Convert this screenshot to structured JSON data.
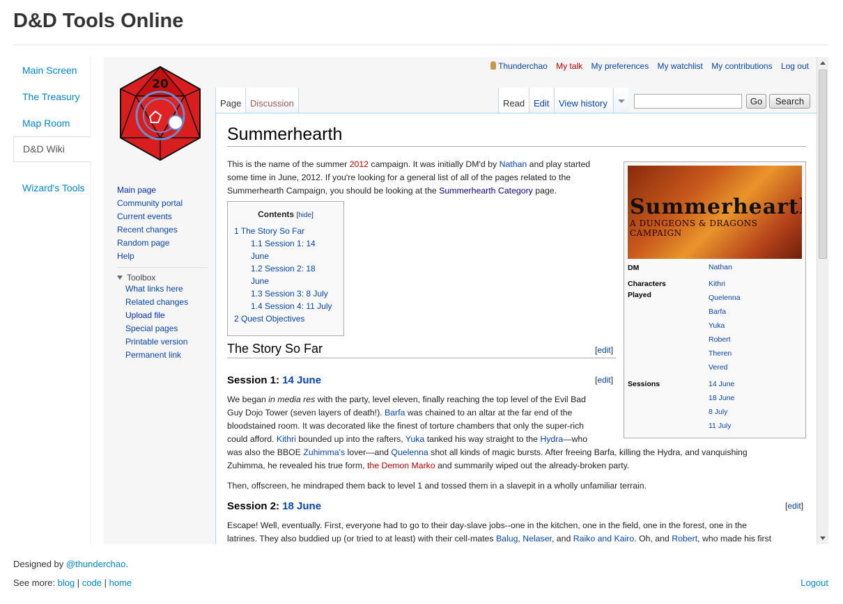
{
  "site": {
    "title": "D&D Tools Online"
  },
  "site_nav": [
    {
      "label": "Main Screen",
      "active": false
    },
    {
      "label": "The Treasury",
      "active": false
    },
    {
      "label": "Map Room",
      "active": false
    },
    {
      "label": "D&D Wiki",
      "active": true
    },
    {
      "label": "Wizard's Tools",
      "active": false
    }
  ],
  "personal": {
    "user": "Thunderchao",
    "talk": "My talk",
    "preferences": "My preferences",
    "watchlist": "My watchlist",
    "contributions": "My contributions",
    "logout": "Log out"
  },
  "tabs": {
    "page": "Page",
    "discussion": "Discussion",
    "read": "Read",
    "edit": "Edit",
    "history": "View history"
  },
  "search": {
    "value": "",
    "go": "Go",
    "search": "Search"
  },
  "logo": {
    "number": "20"
  },
  "wiki_nav": [
    "Main page",
    "Community portal",
    "Current events",
    "Recent changes",
    "Random page",
    "Help"
  ],
  "toolbox": {
    "title": "Toolbox",
    "items": [
      "What links here",
      "Related changes",
      "Upload file",
      "Special pages",
      "Printable version",
      "Permanent link"
    ]
  },
  "article": {
    "title": "Summerhearth",
    "intro": {
      "t1": "This is the name of the summer ",
      "year": "2012",
      "t2": " campaign. It was initially DM'd by ",
      "dm": "Nathan",
      "t3": " and play started",
      "t4": "some time in June, 2012. If you're looking for a general list of all of the pages related to the",
      "t5": "Summerhearth Campaign, you should be looking at the ",
      "cat": "Summerhearth Category",
      "t6": " page."
    },
    "toc": {
      "title": "Contents",
      "hide": "hide",
      "entries": [
        "1 The Story So Far",
        "1.1 Session 1: 14",
        "June",
        "1.2 Session 2: 18",
        "June",
        "1.3 Session 3: 8 July",
        "1.4 Session 4: 11 July",
        "2 Quest Objectives"
      ]
    },
    "edit_label": "edit",
    "story_heading": "The Story So Far",
    "session1": {
      "heading": "Session 1: ",
      "date": "14 June",
      "l1a": "We began ",
      "l1b": "in media res",
      "l1c": " with the party, level eleven, finally reaching the top level of the Evil Bad",
      "l2a": "Guy Dojo Tower (seven layers of death!). ",
      "l2b": "Barfa",
      "l2c": " was chained to an altar at the far end of the",
      "l3": "bloodstained room. It was decorated like the finest of torture chambers that only the super-rich",
      "l4a": "could afford. ",
      "l4b": "Kithri",
      "l4c": " bounded up into the rafters, ",
      "l4d": "Yuka",
      "l4e": " tanked his way straight to the ",
      "l4f": "Hydra",
      "l4g": "—who",
      "l5a": "was also the BBOE ",
      "l5b": "Zuhimma's",
      "l5c": " lover—and ",
      "l5d": "Quelenna",
      "l5e": " shot all kinds of magic bursts. After freeing Barfa, killing the Hydra, and vanquishing",
      "l6a": "Zuhimma, he revealed his true form, ",
      "l6b": "the Demon Marko",
      "l6c": " and summarily wiped out the already-broken party.",
      "p2": "Then, offscreen, he mindraped them back to level 1 and tossed them in a slavepit in a wholly unfamiliar terrain."
    },
    "session2": {
      "heading": "Session 2: ",
      "date": "18 June",
      "l1": "Escape! Well, eventually. First, everyone had to go to their day-slave jobs--one in the kitchen, one in the field, one in the forest, one in the",
      "l2a": "latrines. They also buddied up (or tried to at least) with their cell-mates ",
      "l2b": "Balug",
      "l2c": ", ",
      "l2d": "Nelaser",
      "l2e": ", and ",
      "l2f": "Raiko and Kairo",
      "l2g": ". Oh, and ",
      "l2h": "Robert",
      "l2i": ", who made his first"
    },
    "infobox": {
      "banner_title": "Summerhearth",
      "banner_sub": "A DUNGEONS & DRAGONS CAMPAIGN",
      "dm_label": "DM",
      "dm": "Nathan",
      "chars_label": "Characters",
      "chars_label2": "Played",
      "characters": [
        "Kithri",
        "Quelenna",
        "Barfa",
        "Yuka",
        "Robert",
        "Theren",
        "Vered"
      ],
      "sessions_label": "Sessions",
      "sessions": [
        "14 June",
        "18 June",
        "8 July",
        "11 July"
      ]
    }
  },
  "footer": {
    "designed_by": "Designed by ",
    "handle": "@thunderchao",
    "dot": ".",
    "see_more": "See more: ",
    "blog": "blog",
    "sep": " | ",
    "code": "code",
    "home": "home",
    "logout": "Logout"
  }
}
